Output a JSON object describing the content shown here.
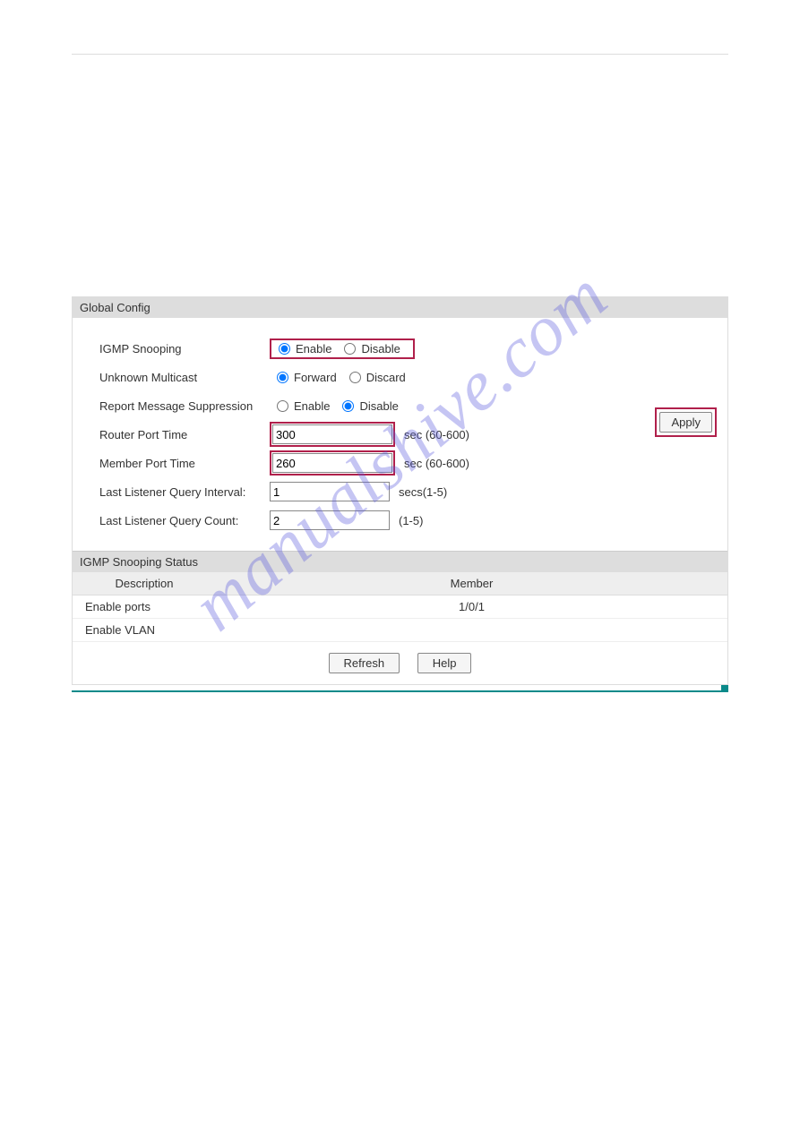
{
  "watermark": "manualshive.com",
  "global_config": {
    "title": "Global Config",
    "igmp_snooping": {
      "label": "IGMP Snooping",
      "opt1": "Enable",
      "opt2": "Disable",
      "selected": "Enable"
    },
    "unknown_multicast": {
      "label": "Unknown Multicast",
      "opt1": "Forward",
      "opt2": "Discard",
      "selected": "Forward"
    },
    "report_suppression": {
      "label": "Report Message Suppression",
      "opt1": "Enable",
      "opt2": "Disable",
      "selected": "Disable"
    },
    "router_port_time": {
      "label": "Router Port Time",
      "value": "300",
      "hint": "sec (60-600)"
    },
    "member_port_time": {
      "label": "Member Port Time",
      "value": "260",
      "hint": "sec (60-600)"
    },
    "last_query_interval": {
      "label": "Last Listener Query Interval:",
      "value": "1",
      "hint": "secs(1-5)"
    },
    "last_query_count": {
      "label": "Last Listener Query Count:",
      "value": "2",
      "hint": "(1-5)"
    },
    "apply_label": "Apply"
  },
  "status": {
    "title": "IGMP Snooping Status",
    "col_description": "Description",
    "col_member": "Member",
    "rows": [
      {
        "description": "Enable ports",
        "member": "1/0/1"
      },
      {
        "description": "Enable VLAN",
        "member": ""
      }
    ]
  },
  "buttons": {
    "refresh": "Refresh",
    "help": "Help"
  }
}
